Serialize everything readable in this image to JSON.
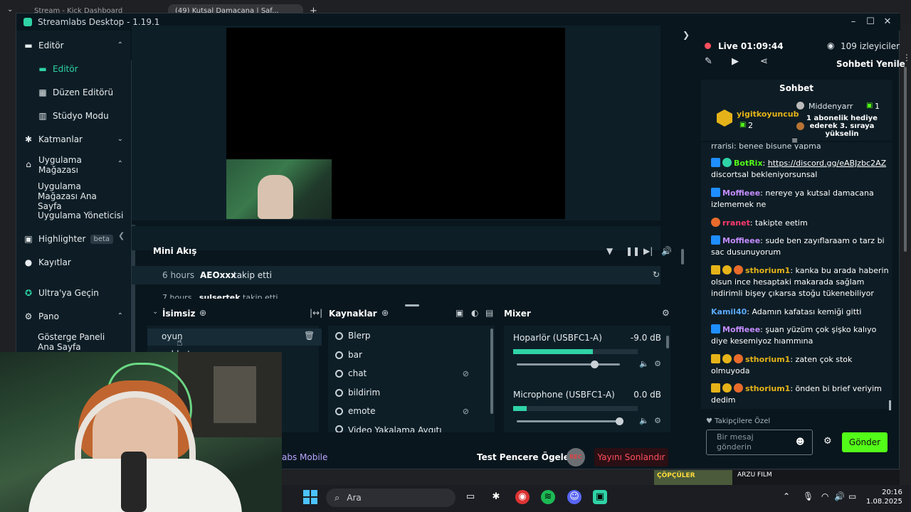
{
  "browser": {
    "tabs": [
      {
        "label": "Stream - Kick Dashboard"
      },
      {
        "label": "(49) Kutsal Damacana | Saf..."
      }
    ],
    "new_tab_icon": "plus-icon"
  },
  "window": {
    "title": "Streamlabs Desktop - 1.19.1"
  },
  "sidebar": {
    "editor_section": "Editör",
    "editor_item": "Editör",
    "layout_editor": "Düzen Editörü",
    "studio_mode": "Stüdyo Modu",
    "layers": "Katmanlar",
    "app_store": "Uygulama Mağazası",
    "app_store_home": "Uygulama Mağazası Ana Sayfa",
    "app_manager": "Uygulama Yöneticisi",
    "highlighter": "Highlighter",
    "beta": "beta",
    "recordings": "Kayıtlar",
    "ultra": "Ultra'ya Geçin",
    "dashboard": "Pano",
    "dashboard_home": "Gösterge Paneli Ana Sayfa"
  },
  "mini_feed": {
    "title": "Mini Akış",
    "time": "6 hours",
    "user": "AEOxxx",
    "action": "takip etti",
    "time2": "7 hours",
    "user2": "sulsertek",
    "action2": "takip etti"
  },
  "scenes": {
    "title": "İsimsiz",
    "items": [
      "oyun",
      "sohbet"
    ]
  },
  "sources": {
    "title": "Kaynaklar",
    "items": [
      "Blerp",
      "bar",
      "chat",
      "bildirim",
      "emote",
      "Video Yakalama Aygıtı"
    ]
  },
  "mixer": {
    "title": "Mixer",
    "ch1_name": "Hoparlör (USBFC1-A)",
    "ch1_db": "-9.0 dB",
    "ch1_level": 0.64,
    "ch1_vol": 0.76,
    "ch2_name": "Microphone (USBFC1-A)",
    "ch2_db": "0.0 dB",
    "ch2_level": 0.11,
    "ch2_vol": 1.0
  },
  "bottom": {
    "mobile": "abs Mobile",
    "test": "Test Pencere Ögeleri",
    "rec": "REC",
    "end": "Yayını Sonlandır"
  },
  "live": {
    "status": "Live 01:09:44",
    "viewers": "109 izleyiciler",
    "refresh": "Sohbeti Yenile"
  },
  "chat": {
    "title": "Sohbet",
    "top_user": "yigitkoyuncub",
    "top_count": "2",
    "top2_user": "Middenyarr",
    "top2_count": "1",
    "sub_goal": "1 abonelik hediye ederek 3. sıraya yükselin",
    "partial": "rrarisi: benee bisune yapma",
    "messages": [
      {
        "user": "BotRix",
        "sep": ": ",
        "link": "https://discord.gg/eABJzbc2AZ",
        "text": "discortsal bekleniyorsunsal"
      },
      {
        "user": "Moffieee",
        "sep": ": ",
        "text": "nereye ya kutsal damacana izlememek ne"
      },
      {
        "user": "rranet",
        "sep": ": ",
        "text": "takipte eetim"
      },
      {
        "user": "Moffieee",
        "sep": ": ",
        "text": "sude ben zayıflaraam o tarz bi sac dusunuyorum"
      },
      {
        "user": "sthorium1",
        "sep": ": ",
        "text": "kanka bu arada haberin olsun ince hesaptaki makarada sağlam indirimli bişey çıkarsa stoğu tükenebiliyor"
      },
      {
        "user": "Kamil40",
        "sep": ": ",
        "text": "Adamın kafatası kemiği gitti"
      },
      {
        "user": "Moffieee",
        "sep": ": ",
        "text": "şuan yüzüm çok şişko kalıyo diye kesemiyoz hıammına"
      },
      {
        "user": "sthorium1",
        "sep": ": ",
        "text": "zaten çok stok olmuyoda"
      },
      {
        "user": "sthorium1",
        "sep": ": ",
        "text": "önden bi brief veriyim dedim"
      }
    ],
    "followers_only": "Takipçilere Özel",
    "input_placeholder": "Bir mesaj gönderin",
    "send": "Gönder"
  },
  "taskbar": {
    "search": "Ara",
    "time": "20:16",
    "date": "1.08.2025",
    "yt_channel": "ÇÖPÇÜLER",
    "yt_title": "ARZU FILM"
  },
  "colors": {
    "accent": "#2fd3a6",
    "send": "#53fc18",
    "live": "#ff4f5e",
    "end": "#ff4f5e"
  }
}
